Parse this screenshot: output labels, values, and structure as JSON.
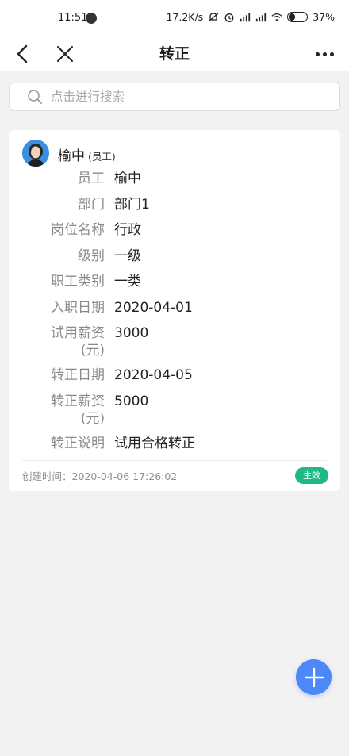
{
  "status_bar": {
    "time": "11:51",
    "net_speed": "17.2K/s",
    "battery": "37%",
    "battery_level": 0.37
  },
  "nav": {
    "title": "转正"
  },
  "search": {
    "placeholder": "点击进行搜索"
  },
  "record": {
    "name": "榆中",
    "role_tag": "(员工)",
    "fields": [
      {
        "label": "员工",
        "value": "榆中"
      },
      {
        "label": "部门",
        "value": "部门1"
      },
      {
        "label": "岗位名称",
        "value": "行政"
      },
      {
        "label": "级别",
        "value": "一级"
      },
      {
        "label": "职工类别",
        "value": "一类"
      },
      {
        "label": "入职日期",
        "value": "2020-04-01"
      },
      {
        "label": "试用薪资",
        "label2": "(元)",
        "value": "3000"
      },
      {
        "label": "转正日期",
        "value": "2020-04-05"
      },
      {
        "label": "转正薪资",
        "label2": "(元)",
        "value": "5000"
      },
      {
        "label": "转正说明",
        "value": "试用合格转正"
      }
    ],
    "created": "创建时间：2020-04-06 17:26:02",
    "status": "生效"
  },
  "colors": {
    "accent": "#4e87f7",
    "status_green": "#1fb986"
  }
}
